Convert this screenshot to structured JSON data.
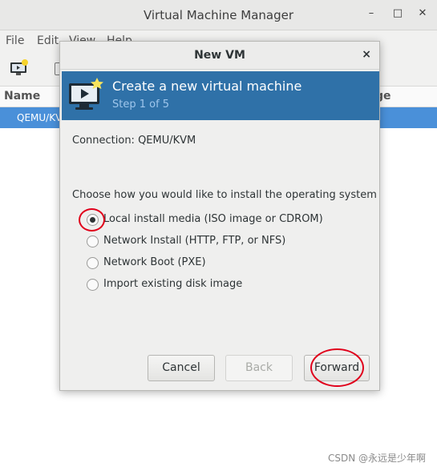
{
  "main_window": {
    "title": "Virtual Machine Manager",
    "minimize_glyph": "–",
    "maximize_glyph": "□",
    "close_glyph": "✕",
    "menu": [
      "File",
      "Edit",
      "View",
      "Help"
    ],
    "list_header": {
      "name": "Name",
      "usage_fragment": "ge"
    },
    "rows": [
      {
        "name": "QEMU/KVM"
      }
    ]
  },
  "dialog": {
    "title": "New VM",
    "close_glyph": "×",
    "banner": {
      "title": "Create a new virtual machine",
      "subtitle": "Step 1 of 5"
    },
    "connection": "Connection:  QEMU/KVM",
    "choose_label": "Choose how you would like to install the operating system",
    "options": [
      {
        "label": "Local install media (ISO image or CDROM)",
        "checked": true
      },
      {
        "label": "Network Install (HTTP, FTP, or NFS)",
        "checked": false
      },
      {
        "label": "Network Boot (PXE)",
        "checked": false
      },
      {
        "label": "Import existing disk image",
        "checked": false
      }
    ],
    "buttons": {
      "cancel": "Cancel",
      "back": "Back",
      "forward": "Forward"
    }
  },
  "watermark": "CSDN @永远是少年啊",
  "colors": {
    "banner": "#2f71a8",
    "selection": "#4a90d9",
    "annotation": "#e0001b"
  },
  "icons": [
    "new-vm-icon",
    "monitor-star-icon",
    "close-icon",
    "minimize-icon",
    "maximize-icon"
  ]
}
